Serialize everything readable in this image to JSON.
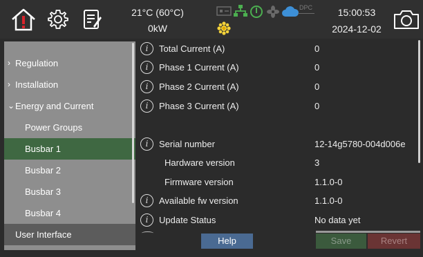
{
  "status": {
    "temperature": "21°C (60°C)",
    "power": "0kW",
    "time": "15:00:53",
    "date": "2024-12-02",
    "dpc_label": "DPC"
  },
  "icons": {
    "home": "home-alert-icon",
    "settings": "gear-icon",
    "notes": "notepad-icon",
    "camera": "camera-icon",
    "network": "network-icon",
    "power": "power-icon",
    "fan": "fan-icon",
    "cloud": "cloud-icon",
    "sun": "sun-icon",
    "info": "info-icon"
  },
  "sidebar": {
    "items": [
      {
        "label": "Regulation",
        "chevron": "›"
      },
      {
        "label": "Installation",
        "chevron": "›"
      },
      {
        "label": "Energy and Current",
        "chevron": "⌄"
      },
      {
        "label": "Power Groups"
      },
      {
        "label": "Busbar 1"
      },
      {
        "label": "Busbar 2"
      },
      {
        "label": "Busbar 3"
      },
      {
        "label": "Busbar 4"
      },
      {
        "label": "User Interface"
      }
    ]
  },
  "main": {
    "rows": [
      {
        "label": "Total Current (A)",
        "value": "0"
      },
      {
        "label": "Phase 1 Current (A)",
        "value": "0"
      },
      {
        "label": "Phase 2 Current (A)",
        "value": "0"
      },
      {
        "label": "Phase 3 Current (A)",
        "value": "0"
      },
      {
        "label": "Serial number",
        "value": "12-14g5780-004d006e"
      },
      {
        "label": "Hardware version",
        "value": "3"
      },
      {
        "label": "Firmware version",
        "value": "1.1.0-0"
      },
      {
        "label": "Available fw version",
        "value": "1.1.0-0"
      },
      {
        "label": "Update Status",
        "value": "No data yet"
      }
    ]
  },
  "buttons": {
    "help": "Help",
    "save": "Save",
    "revert": "Revert"
  },
  "colors": {
    "accent_green": "#3f6842",
    "help_blue": "#4a6a92",
    "alert_red": "#d9232b",
    "network_green": "#4caf50",
    "cloud_blue": "#3d8fd6",
    "sun_yellow": "#f3d23a"
  }
}
